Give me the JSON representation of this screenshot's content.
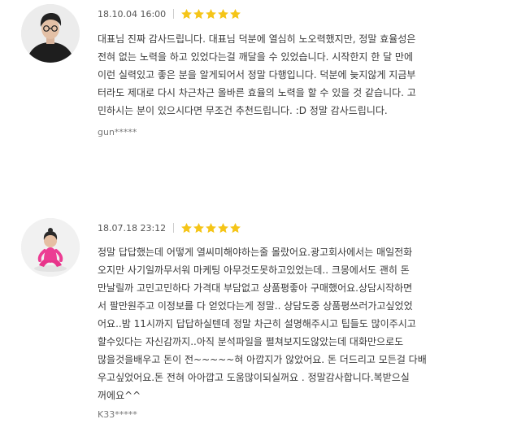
{
  "colors": {
    "star": "#f5c518",
    "text": "#3a3a3a",
    "meta": "#555555",
    "author": "#777777",
    "separator": "#cccccc"
  },
  "reviews": [
    {
      "date": "18.10.04 16:00",
      "rating": 5,
      "avatar_icon": "user-avatar-photo",
      "body_lines": [
        "대표님 진짜 감사드립니다. 대표님 덕분에 열심히 노오력했지만, 정말 효율성은",
        "전혀 없는 노력을 하고 있었다는걸 깨달을 수 있었습니다. 시작한지 한 달 만에",
        "이런 실력있고 좋은 분을 알게되어서 정말 다행입니다. 덕분에 늦지않게 지금부",
        "터라도 제대로 다시 차근차근 올바른 효율의 노력을 할 수 있을 것 같습니다. 고",
        "민하시는 분이 있으시다면 무조건 추천드립니다. :D 정말 감사드립니다."
      ],
      "author": "gun*****"
    },
    {
      "date": "18.07.18 23:12",
      "rating": 5,
      "avatar_icon": "child-avatar-photo",
      "body_lines": [
        "정말 답답했는데 어떻게 열씨미해야하는줄 몰랐어요.광고회사에서는 매일전화",
        "오지만 사기일까무서워 마케팅 아무것도못하고있었는데.. 크몽에서도 괜히 돈",
        "만날릴까 고민고민하다 가격대 부담없고 상품평좋아 구매했어요.상담시작하면",
        "서 팔만원주고 이정보를 다 얻었다는게 정말.. 상담도중 상품평쓰러가고싶었었",
        "어요..밤 11시까지 답답하실텐데 정말 차근히 설명해주시고 팁들도 많이주시고",
        "할수있다는 자신감까지..아직 분석파일을 펼쳐보지도않았는데 대화만으로도",
        "많을것을배우고 돈이 전~~~~~혀 아깝지가 않았어요. 돈 더드리고 모든걸 다배",
        "우고싶었어요.돈 전혀 아아깝고 도움많이되실꺼요 . 정말감사합니다.복받으실",
        "꺼에요^^"
      ],
      "author": "K33*****"
    }
  ]
}
